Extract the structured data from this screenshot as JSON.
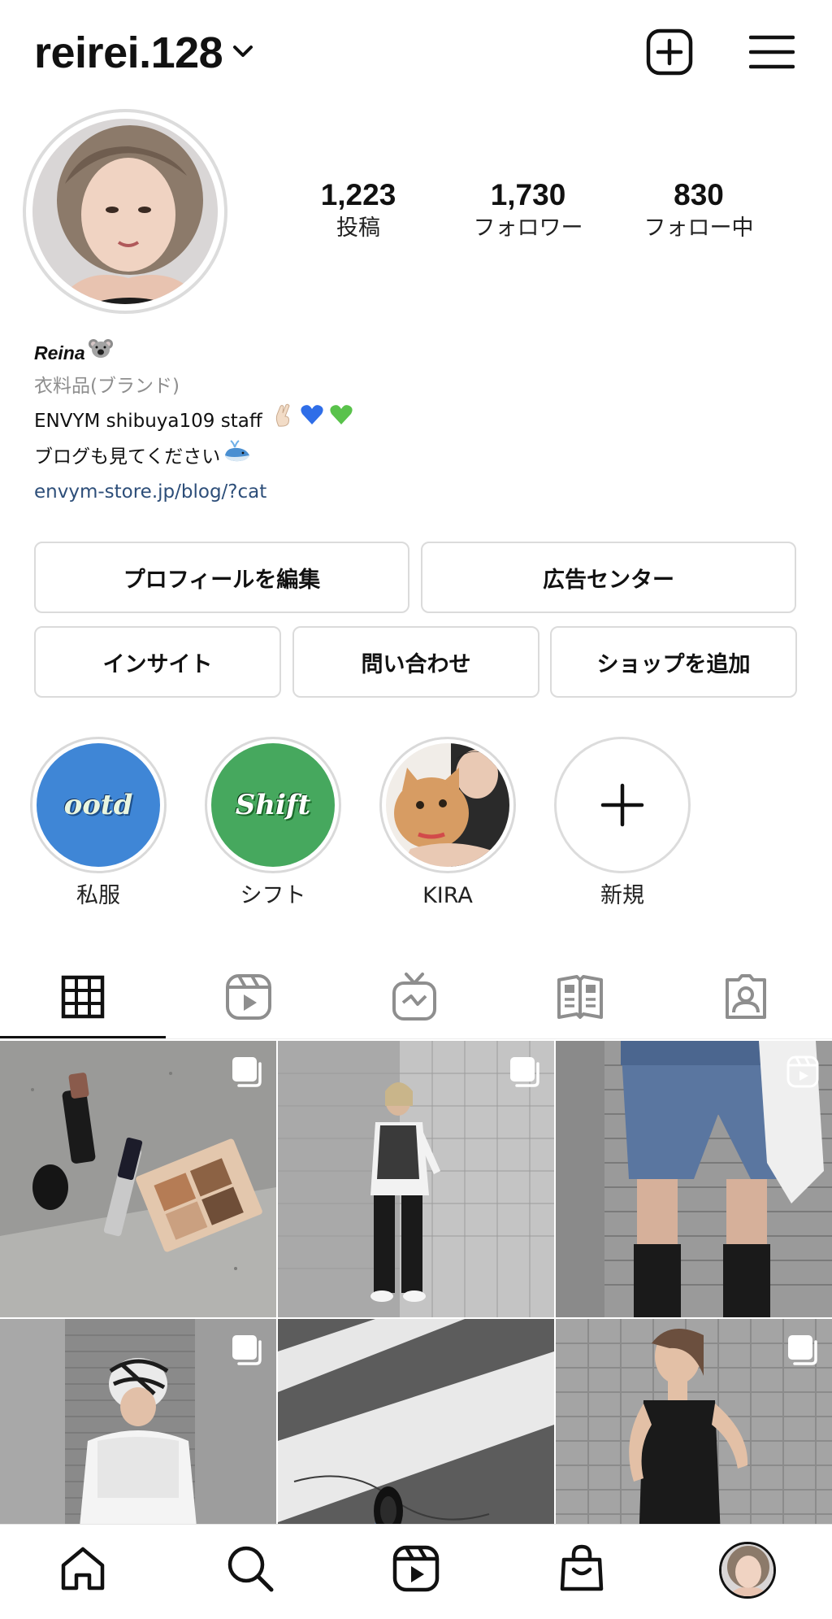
{
  "header": {
    "username": "reirei.128",
    "icons": {
      "switch": "chevron-down-icon",
      "create": "plus-square-icon",
      "menu": "hamburger-menu-icon"
    }
  },
  "profile": {
    "stats": [
      {
        "value": "1,223",
        "label": "投稿"
      },
      {
        "value": "1,730",
        "label": "フォロワー"
      },
      {
        "value": "830",
        "label": "フォロー中"
      }
    ],
    "name": "Reina",
    "name_emoji": "koala-emoji",
    "category": "衣料品(ブランド)",
    "bio_line1": "ENVYM shibuya109 staff",
    "bio_line1_emojis": [
      "crossed-fingers-emoji",
      "blue-heart-emoji",
      "green-heart-emoji"
    ],
    "bio_line2": "ブログも見てください",
    "bio_line2_emoji": "whale-emoji",
    "link": "envym-store.jp/blog/?cat"
  },
  "buttons": {
    "edit_profile": "プロフィールを編集",
    "ad_center": "広告センター",
    "insights": "インサイト",
    "contact": "問い合わせ",
    "add_shop": "ショップを追加"
  },
  "highlights": [
    {
      "label": "私服",
      "cover_text": "ootd",
      "color": "#3f86d6"
    },
    {
      "label": "シフト",
      "cover_text": "Shift",
      "color": "#46a85e"
    },
    {
      "label": "KIRA",
      "cover_text": "",
      "color": "#c9a07a"
    },
    {
      "label": "新規",
      "cover_text": "",
      "color": "#ffffff"
    }
  ],
  "tabs": [
    "grid-icon",
    "reels-icon",
    "igtv-icon",
    "guides-icon",
    "tagged-icon"
  ],
  "posts": [
    {
      "type": "carousel",
      "subject": "cosmetics"
    },
    {
      "type": "carousel",
      "subject": "outfit"
    },
    {
      "type": "reel",
      "subject": "denim-shorts"
    },
    {
      "type": "carousel",
      "subject": "bucket-hat"
    },
    {
      "type": "photo",
      "subject": "crosswalk"
    },
    {
      "type": "carousel",
      "subject": "knit-top"
    }
  ],
  "bottom_nav": [
    "home-icon",
    "search-icon",
    "reels-icon",
    "shop-icon",
    "profile-avatar"
  ]
}
